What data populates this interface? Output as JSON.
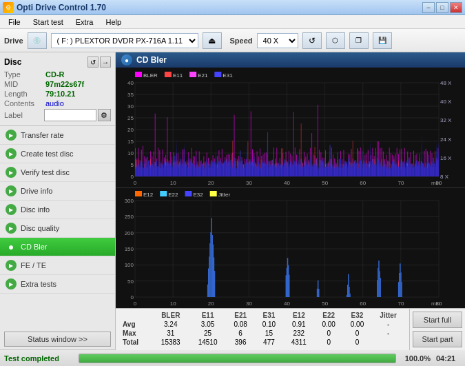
{
  "titlebar": {
    "title": "Opti Drive Control 1.70",
    "icon": "⚙",
    "minimize_label": "–",
    "maximize_label": "□",
    "close_label": "✕"
  },
  "menubar": {
    "items": [
      {
        "label": "File"
      },
      {
        "label": "Start test"
      },
      {
        "label": "Extra"
      },
      {
        "label": "Help"
      }
    ]
  },
  "drivebar": {
    "drive_label": "Drive",
    "drive_value": "(F:)  PLEXTOR DVDR  PX-716A 1.11",
    "speed_label": "Speed",
    "speed_value": "40 X",
    "eject_icon": "⏏",
    "refresh_icon": "↺",
    "eraser_icon": "◫",
    "save_icon": "💾",
    "copy_icon": "❐"
  },
  "disc": {
    "title": "Disc",
    "type_label": "Type",
    "type_value": "CD-R",
    "mid_label": "MID",
    "mid_value": "97m22s67f",
    "length_label": "Length",
    "length_value": "79:10.21",
    "contents_label": "Contents",
    "contents_value": "audio",
    "label_label": "Label",
    "label_value": ""
  },
  "nav": {
    "items": [
      {
        "id": "transfer-rate",
        "label": "Transfer rate",
        "active": false
      },
      {
        "id": "create-test-disc",
        "label": "Create test disc",
        "active": false
      },
      {
        "id": "verify-test-disc",
        "label": "Verify test disc",
        "active": false
      },
      {
        "id": "drive-info",
        "label": "Drive info",
        "active": false
      },
      {
        "id": "disc-info",
        "label": "Disc info",
        "active": false
      },
      {
        "id": "disc-quality",
        "label": "Disc quality",
        "active": false
      },
      {
        "id": "cd-bler",
        "label": "CD Bler",
        "active": true
      },
      {
        "id": "fe-te",
        "label": "FE / TE",
        "active": false
      },
      {
        "id": "extra-tests",
        "label": "Extra tests",
        "active": false
      }
    ],
    "status_window_label": "Status window >>"
  },
  "chart": {
    "title": "CD Bler",
    "upper": {
      "legend": [
        {
          "color": "#ff00ff",
          "label": "BLER"
        },
        {
          "color": "#ff4444",
          "label": "E11"
        },
        {
          "color": "#ff44ff",
          "label": "E21"
        },
        {
          "color": "#4444ff",
          "label": "E31"
        }
      ],
      "y_max": 40,
      "y_labels": [
        "40",
        "35",
        "30",
        "25",
        "20",
        "15",
        "10",
        "5",
        "0"
      ],
      "x_labels": [
        "0",
        "10",
        "20",
        "30",
        "40",
        "50",
        "60",
        "70",
        "80"
      ],
      "right_labels": [
        "48 X",
        "40 X",
        "32 X",
        "24 X",
        "16 X",
        "8 X"
      ],
      "x_unit": "min"
    },
    "lower": {
      "legend": [
        {
          "color": "#ff6600",
          "label": "E12"
        },
        {
          "color": "#44ccff",
          "label": "E22"
        },
        {
          "color": "#4444ff",
          "label": "E32"
        },
        {
          "color": "#ffff00",
          "label": "Jitter"
        }
      ],
      "y_max": 300,
      "y_labels": [
        "300",
        "250",
        "200",
        "150",
        "100",
        "50",
        "0"
      ],
      "x_labels": [
        "0",
        "10",
        "20",
        "30",
        "40",
        "50",
        "60",
        "70",
        "80"
      ],
      "x_unit": "min"
    }
  },
  "stats": {
    "columns": [
      "",
      "BLER",
      "E11",
      "E21",
      "E31",
      "E12",
      "E22",
      "E32",
      "Jitter"
    ],
    "rows": [
      {
        "label": "Avg",
        "bler": "3.24",
        "e11": "3.05",
        "e21": "0.08",
        "e31": "0.10",
        "e12": "0.91",
        "e22": "0.00",
        "e32": "0.00",
        "jitter": "-"
      },
      {
        "label": "Max",
        "bler": "31",
        "e11": "25",
        "e21": "6",
        "e31": "15",
        "e12": "232",
        "e22": "0",
        "e32": "0",
        "jitter": "-"
      },
      {
        "label": "Total",
        "bler": "15383",
        "e11": "14510",
        "e21": "396",
        "e31": "477",
        "e12": "4311",
        "e22": "0",
        "e32": "0",
        "jitter": ""
      }
    ],
    "start_full_label": "Start full",
    "start_part_label": "Start part"
  },
  "bottombar": {
    "status": "Test completed",
    "progress": 100.0,
    "progress_text": "100.0%",
    "elapsed": "04:21"
  }
}
